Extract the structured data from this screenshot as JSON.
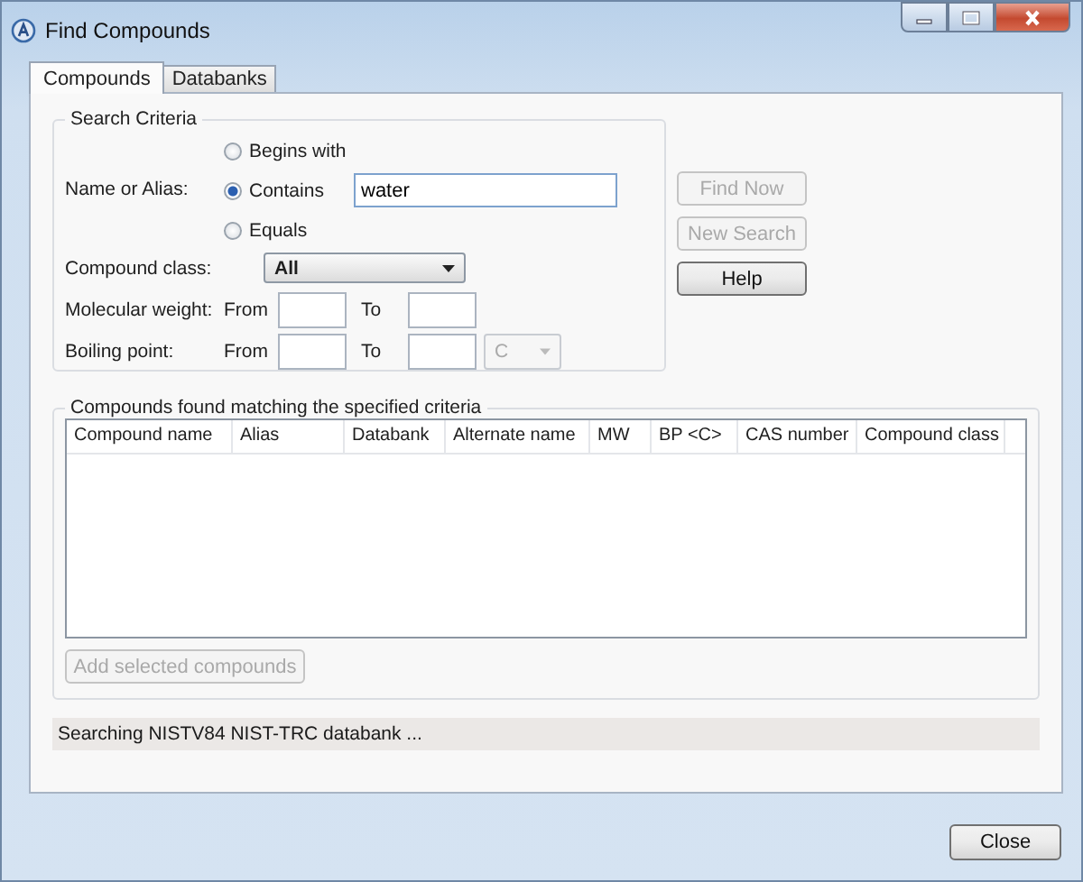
{
  "window": {
    "title": "Find Compounds"
  },
  "tabs": [
    {
      "label": "Compounds",
      "selected": true
    },
    {
      "label": "Databanks",
      "selected": false
    }
  ],
  "search_criteria": {
    "title": "Search Criteria",
    "name_label": "Name or Alias:",
    "match_options": [
      {
        "label": "Begins with",
        "selected": false
      },
      {
        "label": "Contains",
        "selected": true
      },
      {
        "label": "Equals",
        "selected": false
      }
    ],
    "name_value": "water",
    "class_label": "Compound class:",
    "class_value": "All",
    "ranges": [
      {
        "label": "Molecular weight:",
        "from": "From",
        "to": "To"
      },
      {
        "label": "Boiling point:",
        "from": "From",
        "to": "To",
        "unit": {
          "value": "C",
          "disabled": true
        }
      }
    ]
  },
  "buttons": [
    {
      "label": "Find Now",
      "disabled": true
    },
    {
      "label": "New Search",
      "disabled": true
    },
    {
      "label": "Help",
      "disabled": false
    }
  ],
  "results": {
    "title": "Compounds found matching the specified criteria",
    "columns": [
      "Compound name",
      "Alias",
      "Databank",
      "Alternate name",
      "MW",
      "BP <C>",
      "CAS number",
      "Compound class"
    ],
    "add_button": {
      "label": "Add selected compounds",
      "disabled": true
    }
  },
  "status": "Searching NISTV84 NIST-TRC databank ...",
  "close_button": {
    "label": "Close"
  }
}
